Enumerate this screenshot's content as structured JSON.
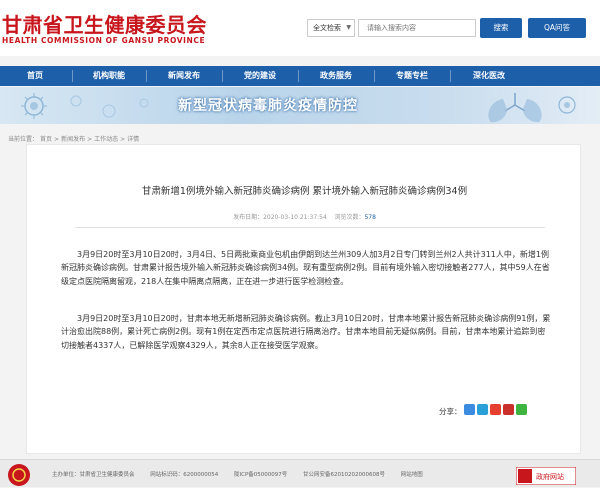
{
  "header": {
    "logo_cn": "甘肃省卫生健康委员会",
    "logo_en": "HEALTH COMMISSION OF GANSU PROVINCE",
    "search_scope": "全文检索",
    "search_placeholder": "请输入搜索内容",
    "search_button": "搜索",
    "qa_button": "QA问答"
  },
  "nav": {
    "items": [
      {
        "label": "首页"
      },
      {
        "label": "机构职能"
      },
      {
        "label": "新闻发布"
      },
      {
        "label": "党的建设"
      },
      {
        "label": "政务服务"
      },
      {
        "label": "专题专栏"
      },
      {
        "label": "深化医改"
      }
    ]
  },
  "banner": {
    "title": "新型冠状病毒肺炎疫情防控"
  },
  "breadcrumb": {
    "prefix": "当前位置：",
    "items": [
      "首页",
      "新闻发布",
      "工作动态",
      "详情"
    ]
  },
  "article": {
    "title": "甘肃新增1例境外输入新冠肺炎确诊病例  累计境外输入新冠肺炎确诊病例34例",
    "meta_date": "发布日期：2020-03-10 21:37:54",
    "meta_views_label": "浏览次数：",
    "meta_views": "578",
    "paragraphs": [
      "3月9日20时至3月10日20时，3月4日、5日两批乘商业包机由伊朗到达兰州309人加3月2日专门转到兰州2人共计311人中，新增1例新冠肺炎确诊病例。甘肃累计报告境外输入新冠肺炎确诊病例34例。现有重型病例2例。目前有境外输入密切接触者277人，其中59人在省级定点医院隔离留观，218人在集中隔离点隔离，正在进一步进行医学检测检查。",
      "3月9日20时至3月10日20时，甘肃本地无新增新冠肺炎确诊病例。截止3月10日20时，甘肃本地累计报告新冠肺炎确诊病例91例，累计治愈出院88例，累计死亡病例2例。现有1例在定西市定点医院进行隔离治疗。甘肃本地目前无疑似病例。目前，甘肃本地累计追踪到密切接触者4337人，已解除医学观察4329人，其余8人正在接受医学观察。"
    ],
    "share_label": "分享："
  },
  "footer": {
    "host": "主办单位：甘肃省卫生健康委员会",
    "site_id": "网站标识码：6200000054",
    "icp": "陇ICP备05000097号",
    "police": "甘公网安备62010202000608号",
    "contact": "网站地图",
    "gov_badge": "政府网站"
  },
  "colors": {
    "brand_red": "#c8161d",
    "nav_blue": "#1d5fa9"
  }
}
